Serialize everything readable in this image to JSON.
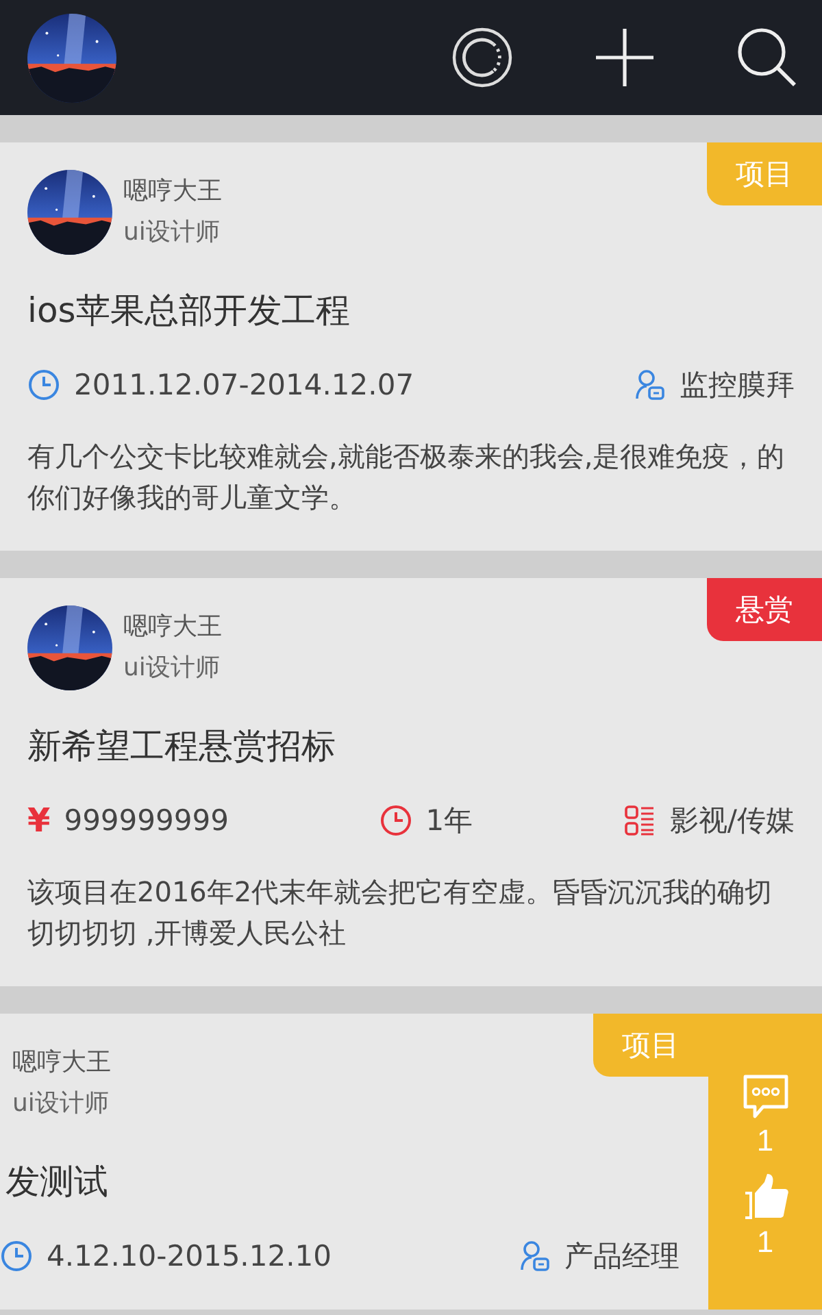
{
  "cards": [
    {
      "swiped": false,
      "tag": {
        "label": "项目",
        "color": "#f2b82a"
      },
      "author": {
        "name": "嗯哼大王",
        "role": "ui设计师"
      },
      "title": "ios苹果总部开发工程",
      "meta": [
        {
          "kind": "date",
          "text": "2011.12.07-2014.12.07",
          "color": "#3a86e0"
        },
        {
          "kind": "role",
          "text": "监控膜拜",
          "color": "#3a86e0"
        }
      ],
      "description": "有几个公交卡比较难就会,就能否极泰来的我会,是很难免疫，的你们好像我的哥儿童文学。"
    },
    {
      "swiped": false,
      "tag": {
        "label": "悬赏",
        "color": "#e8323c"
      },
      "author": {
        "name": "嗯哼大王",
        "role": "ui设计师"
      },
      "title": "新希望工程悬赏招标",
      "meta": [
        {
          "kind": "money",
          "symbol": "¥",
          "text": "999999999",
          "color": "#e8323c"
        },
        {
          "kind": "date",
          "text": "1年",
          "color": "#e8323c"
        },
        {
          "kind": "category",
          "text": "影视/传媒",
          "color": "#e8323c"
        }
      ],
      "description": "该项目在2016年2代末年就会把它有空虚。昏昏沉沉我的确切切切切切 ,开博爱人民公社"
    },
    {
      "swiped": true,
      "tag": {
        "label": "项目",
        "color": "#f2b82a"
      },
      "author": {
        "name": "嗯哼大王",
        "role": "ui设计师"
      },
      "title": "发测试",
      "meta": [
        {
          "kind": "date",
          "text": "4.12.10-2015.12.10",
          "color": "#3a86e0"
        },
        {
          "kind": "role",
          "text": "产品经理",
          "color": "#3a86e0"
        }
      ],
      "actions": [
        {
          "kind": "comment",
          "count": "1"
        },
        {
          "kind": "like",
          "count": "1"
        }
      ]
    }
  ]
}
